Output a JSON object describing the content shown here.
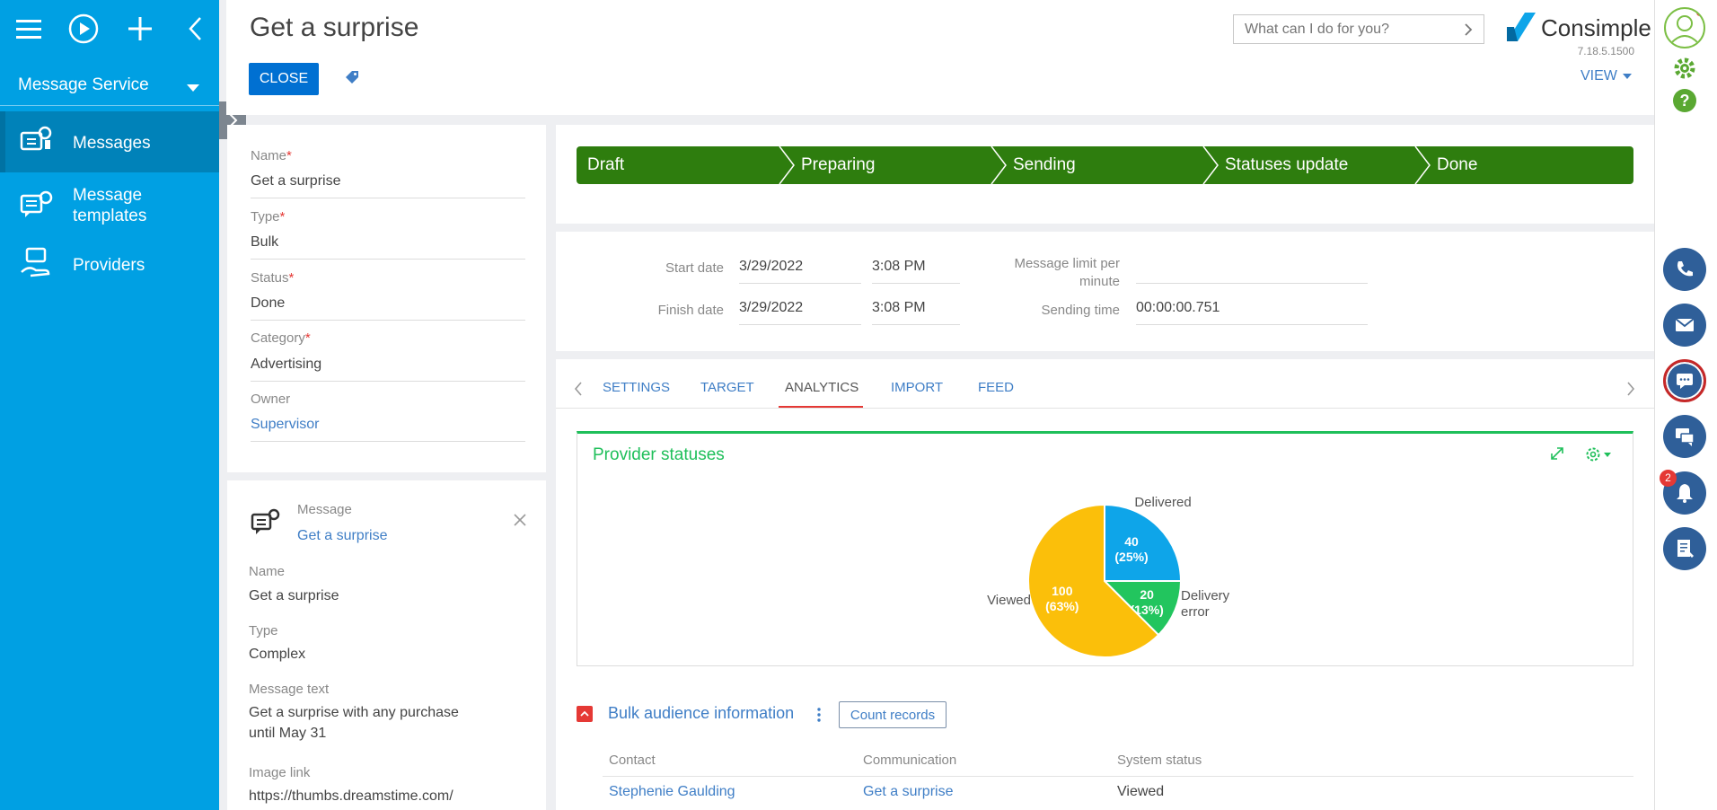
{
  "sidebar": {
    "section": "Message Service",
    "items": [
      {
        "label": "Messages",
        "icon": "messages-icon"
      },
      {
        "label": "Message templates",
        "icon": "message-templates-icon"
      },
      {
        "label": "Providers",
        "icon": "providers-icon"
      }
    ]
  },
  "header": {
    "title": "Get a surprise",
    "close_label": "CLOSE",
    "search_placeholder": "What can I do for you?",
    "logo_text": "Consimple",
    "version": "7.18.5.1500",
    "view_label": "VIEW"
  },
  "form": {
    "name_label": "Name",
    "name_value": "Get a surprise",
    "type_label": "Type",
    "type_value": "Bulk",
    "status_label": "Status",
    "status_value": "Done",
    "category_label": "Category",
    "category_value": "Advertising",
    "owner_label": "Owner",
    "owner_value": "Supervisor",
    "required_mark": "*"
  },
  "message_card": {
    "header_label": "Message",
    "header_link": "Get a surprise",
    "name_label": "Name",
    "name_value": "Get a surprise",
    "type_label": "Type",
    "type_value": "Complex",
    "text_label": "Message text",
    "text_line1": "Get a surprise with any purchase",
    "text_line2": "until May 31",
    "image_label": "Image link",
    "image_value": "https://thumbs.dreamstime.com/"
  },
  "stages": [
    "Draft",
    "Preparing",
    "Sending",
    "Statuses update",
    "Done"
  ],
  "dates": {
    "start_label": "Start date",
    "start_date": "3/29/2022",
    "start_time": "3:08 PM",
    "finish_label": "Finish date",
    "finish_date": "3/29/2022",
    "finish_time": "3:08 PM",
    "limit_label_1": "Message limit per",
    "limit_label_2": "minute",
    "limit_value": "",
    "sending_label": "Sending time",
    "sending_value": "00:00:00.751"
  },
  "tabs": [
    "SETTINGS",
    "TARGET",
    "ANALYTICS",
    "IMPORT",
    "FEED"
  ],
  "active_tab": "ANALYTICS",
  "chart_data": {
    "type": "pie",
    "title": "Provider statuses",
    "slices": [
      {
        "label": "Delivered",
        "value": 40,
        "percent": "25%",
        "color": "#0ea5e9"
      },
      {
        "label": "Delivery error",
        "value": 20,
        "percent": "13%",
        "color": "#22c55e"
      },
      {
        "label": "Viewed",
        "value": 100,
        "percent": "63%",
        "color": "#fbbf0a"
      }
    ]
  },
  "bulk": {
    "title": "Bulk audience information",
    "count_label": "Count records",
    "columns": [
      "Contact",
      "Communication",
      "System status"
    ],
    "rows": [
      {
        "contact": "Stephenie Gaulding",
        "communication": "Get a surprise",
        "status": "Viewed"
      }
    ]
  },
  "notifications": {
    "count": "2"
  },
  "colors": {
    "sidebar": "#00a0e3",
    "stage": "#2e7d0e",
    "accent": "#0070d2",
    "chart_accent": "#1fbf5a"
  }
}
